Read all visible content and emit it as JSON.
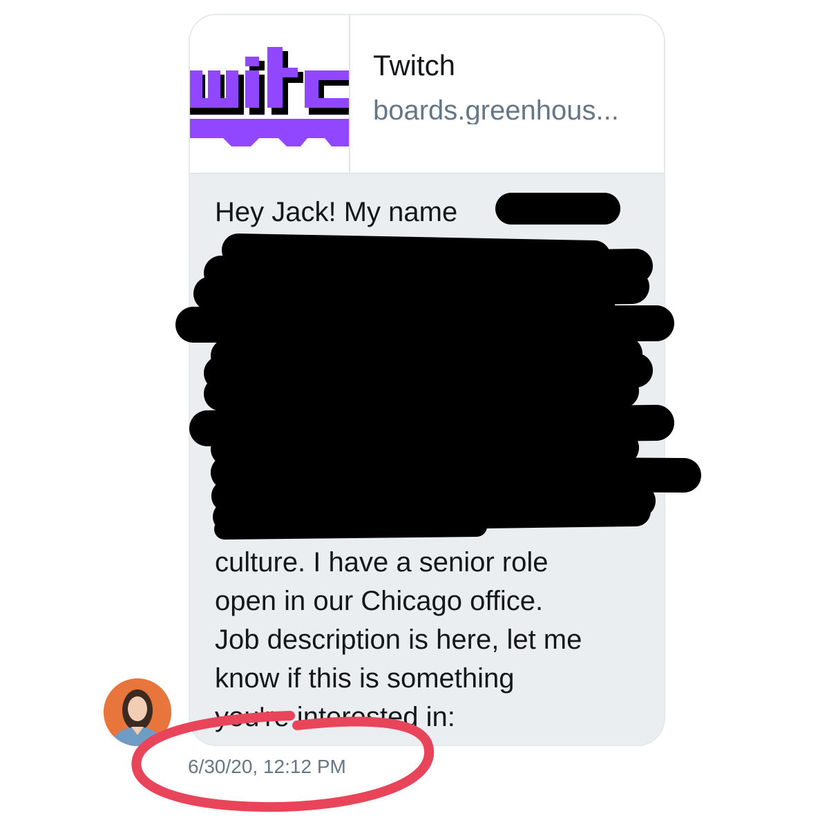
{
  "link_preview": {
    "title": "Twitch",
    "url": "boards.greenhous...",
    "thumbnail_icon": "twitch-logo-icon",
    "brand_color": "#9146ff"
  },
  "message": {
    "lines": [
      "Hey Jack!  My name",
      "culture.  I have a senior role",
      "open in our Chicago office.",
      "Job description is here, let me",
      "know if this is something",
      "you're interested in:"
    ],
    "redaction_color": "#000000"
  },
  "sender": {
    "avatar_icon": "avatar-photo-icon"
  },
  "timestamp": "6/30/20, 12:12 PM",
  "annotation": {
    "circle_color": "#e8445a"
  }
}
